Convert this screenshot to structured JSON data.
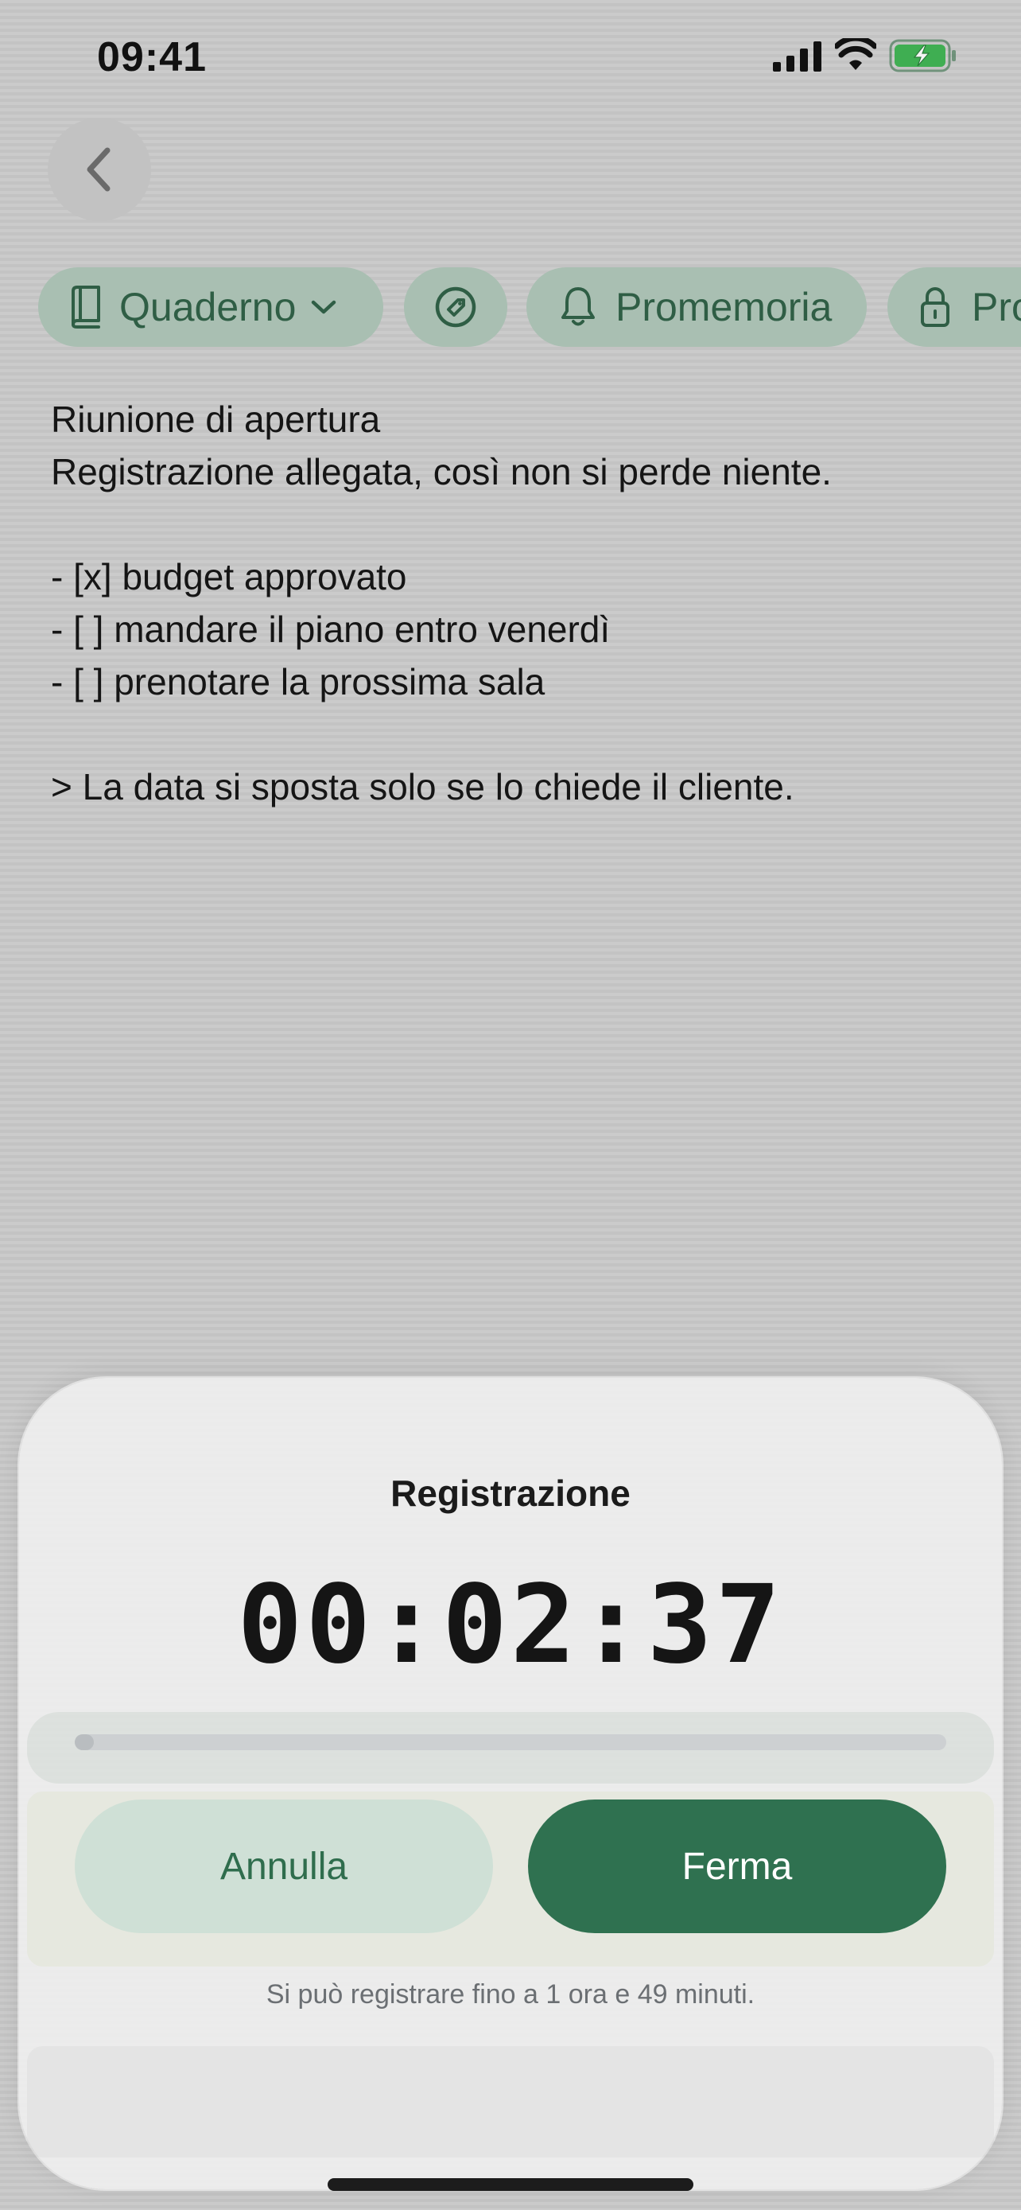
{
  "status_bar": {
    "time": "09:41"
  },
  "chips": {
    "notebook": "Quaderno",
    "reminder": "Promemoria",
    "lock": "Pro"
  },
  "note": {
    "lines": [
      "Riunione di apertura",
      "Registrazione allegata, così non si perde niente.",
      "",
      "- [x] budget approvato",
      "- [ ] mandare il piano entro venerdì",
      "- [ ] prenotare la prossima sala",
      "",
      "> La data si sposta solo se lo chiede il cliente."
    ]
  },
  "recording_sheet": {
    "title": "Registrazione",
    "timer": "00:02:37",
    "cancel_label": "Annulla",
    "stop_label": "Ferma",
    "limit_note": "Si può registrare fino a 1 ora e 49 minuti."
  },
  "colors": {
    "accent": "#2f7150",
    "chip_bg": "#a9bfb2",
    "chip_text": "#2f5e45"
  },
  "icons": [
    "back-icon",
    "notebook-icon",
    "chevron-down-icon",
    "tag-icon",
    "bell-icon",
    "lock-icon",
    "signal-icon",
    "wifi-icon",
    "battery-icon"
  ]
}
